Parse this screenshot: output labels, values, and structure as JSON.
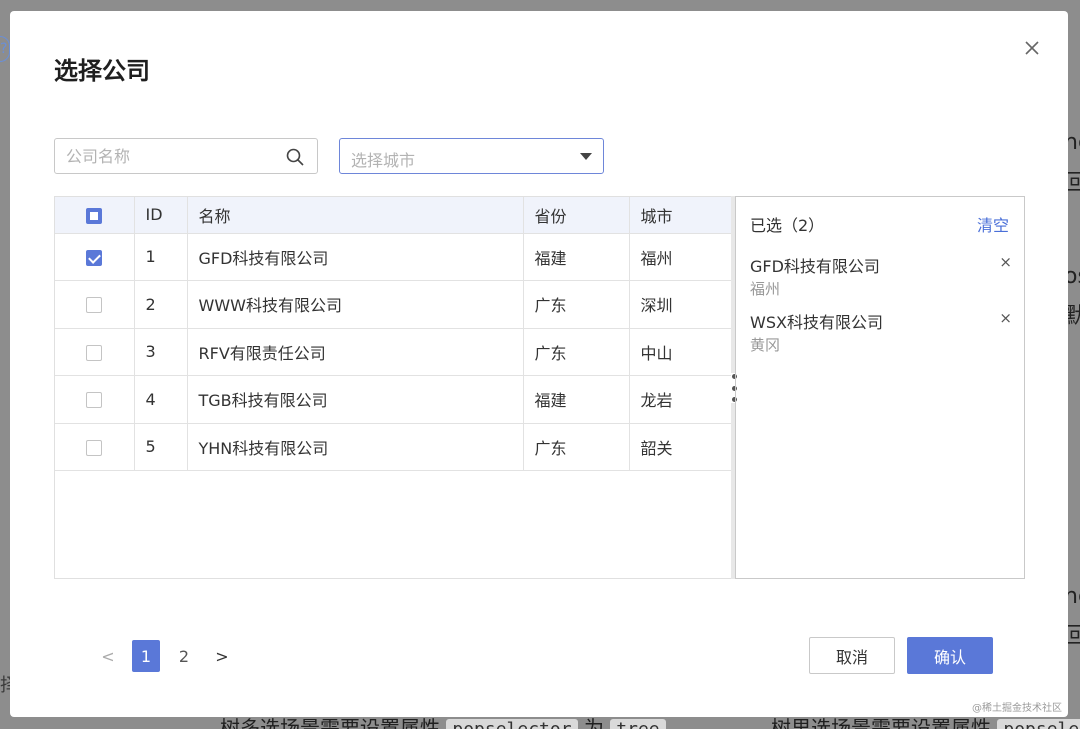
{
  "background": {
    "left_label": "择",
    "bottom_left_text": "树多选场景需要设置属性",
    "bottom_left_chip_1": "popselector",
    "bottom_left_word": "为",
    "bottom_left_chip_2": "tree",
    "bottom_right_text": "树里选场景需要设置属性",
    "bottom_right_chip": "popsele",
    "right_edge_1": "nc",
    "right_edge_2": "回",
    "right_edge_3": "os",
    "right_edge_4": "默",
    "right_edge_5": "nc",
    "right_edge_6": "回"
  },
  "dialog": {
    "title": "选择公司"
  },
  "search": {
    "placeholder": "公司名称"
  },
  "city_select": {
    "placeholder": "选择城市"
  },
  "table": {
    "headers": [
      "ID",
      "名称",
      "省份",
      "城市"
    ],
    "rows": [
      {
        "id": "1",
        "name": "GFD科技有限公司",
        "province": "福建",
        "city": "福州",
        "checked": true
      },
      {
        "id": "2",
        "name": "WWW科技有限公司",
        "province": "广东",
        "city": "深圳",
        "checked": false
      },
      {
        "id": "3",
        "name": "RFV有限责任公司",
        "province": "广东",
        "city": "中山",
        "checked": false
      },
      {
        "id": "4",
        "name": "TGB科技有限公司",
        "province": "福建",
        "city": "龙岩",
        "checked": false
      },
      {
        "id": "5",
        "name": "YHN科技有限公司",
        "province": "广东",
        "city": "韶关",
        "checked": false
      }
    ]
  },
  "selected": {
    "title": "已选（2）",
    "clear_label": "清空",
    "items": [
      {
        "name": "GFD科技有限公司",
        "city": "福州",
        "remove": "×"
      },
      {
        "name": "WSX科技有限公司",
        "city": "黄冈",
        "remove": "×"
      }
    ]
  },
  "pagination": {
    "prev": "<",
    "pages": [
      "1",
      "2"
    ],
    "active_page": "1",
    "next": ">"
  },
  "buttons": {
    "cancel": "取消",
    "confirm": "确认"
  },
  "watermark": "@稀土掘金技术社区",
  "colors": {
    "accent": "#5a78d8",
    "link": "#4a6fd8",
    "header_bg": "#f0f3fb",
    "overlay": "#8d8d8d"
  }
}
